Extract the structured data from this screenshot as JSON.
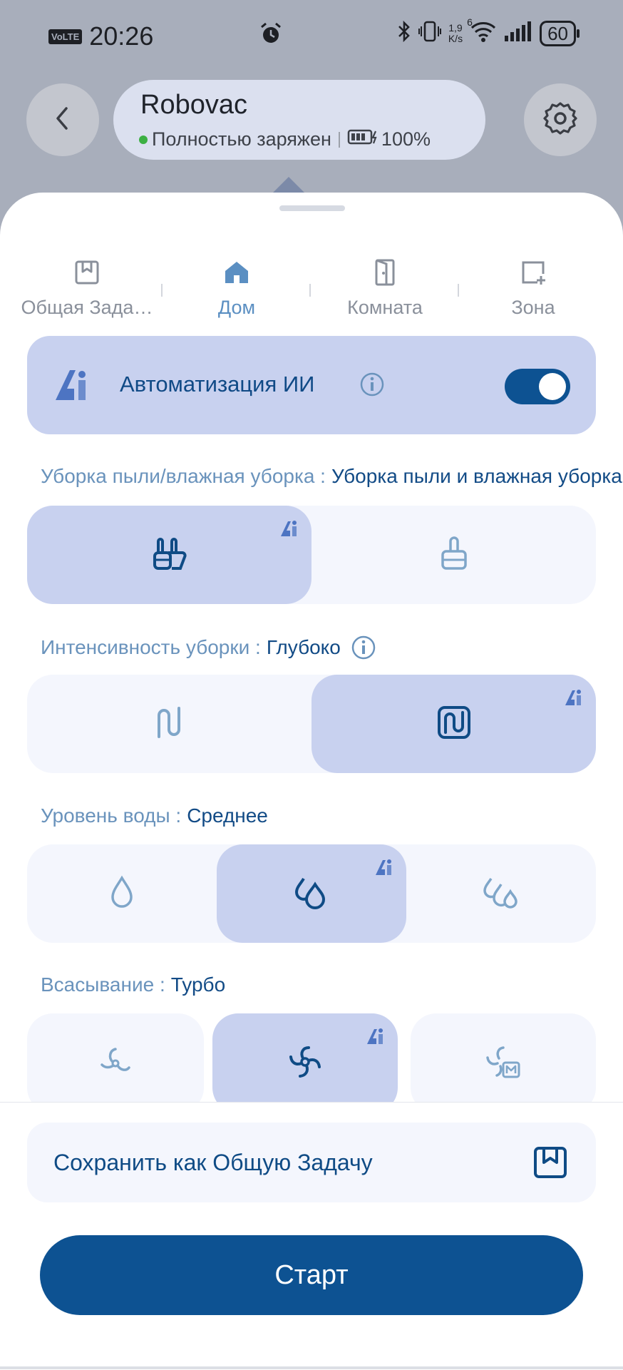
{
  "status_bar": {
    "volte": "VoLTE",
    "time": "20:26",
    "net_speed_value": "1,9",
    "net_speed_unit": "K/s",
    "wifi_label": "6",
    "battery": "60"
  },
  "device": {
    "name": "Robovac",
    "status": "Полностью заряжен",
    "battery": "100%"
  },
  "tabs": [
    {
      "label": "Общая Зада…",
      "icon": "bookmark-icon"
    },
    {
      "label": "Дом",
      "icon": "home-icon"
    },
    {
      "label": "Комната",
      "icon": "door-icon"
    },
    {
      "label": "Зона",
      "icon": "zone-add-icon"
    }
  ],
  "active_tab": "Дом",
  "ai_automation": {
    "title": "Автоматизация ИИ",
    "enabled": true
  },
  "sections": {
    "cleaning_mode": {
      "label": "Уборка пыли/влажная уборка :",
      "value": "Уборка пыли и влажная уборка"
    },
    "intensity": {
      "label": "Интенсивность уборки :",
      "value": "Глубоко"
    },
    "water_level": {
      "label": "Уровень воды :",
      "value": "Среднее"
    },
    "suction": {
      "label": "Всасывание :",
      "value": "Турбо"
    }
  },
  "save_label": "Сохранить как Общую Задачу",
  "start_label": "Старт",
  "colors": {
    "accent": "#0d5292",
    "selected_bg": "#c8d1ef",
    "option_bg": "#f4f6fd",
    "label": "#6a93bc",
    "value": "#124b86"
  }
}
